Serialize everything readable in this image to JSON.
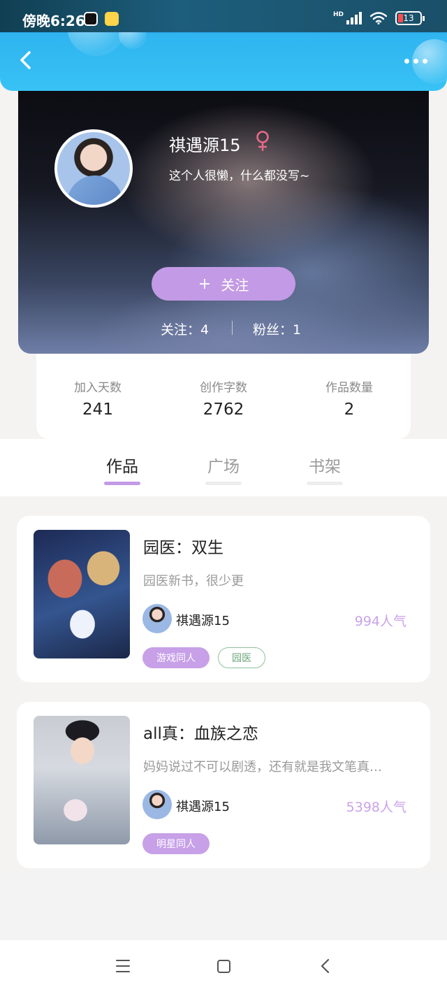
{
  "status_bar": {
    "time": "傍晚6:26",
    "network_label": "HD",
    "battery_level": "13"
  },
  "icons": {
    "back": "chevron-left",
    "more": "more-horizontal",
    "gender": "female-symbol",
    "nav_menu": "menu-lines",
    "nav_home": "square",
    "nav_back": "chevron-left"
  },
  "colors": {
    "accent": "#c39ae5",
    "header_blue": "#38c2f5",
    "gender_pink": "#e66a8a",
    "tag_green": "#6aa67a"
  },
  "profile": {
    "name": "祺遇源15",
    "bio": "这个人很懒，什么都没写~",
    "follow_plus": "+",
    "follow_label": "关注",
    "following": "关注：4",
    "followers": "粉丝：1"
  },
  "stats": [
    {
      "label": "加入天数",
      "value": "241"
    },
    {
      "label": "创作字数",
      "value": "2762"
    },
    {
      "label": "作品数量",
      "value": "2"
    }
  ],
  "tabs": [
    {
      "label": "作品",
      "active": true
    },
    {
      "label": "广场",
      "active": false
    },
    {
      "label": "书架",
      "active": false
    }
  ],
  "works": [
    {
      "title": "园医：双生",
      "description": "园医新书，很少更",
      "author": "祺遇源15",
      "popularity": "994人气",
      "tags": [
        "游戏同人",
        "园医"
      ]
    },
    {
      "title": "all真：血族之恋",
      "description": "妈妈说过不可以剧透，还有就是我文笔真…",
      "author": "祺遇源15",
      "popularity": "5398人气",
      "tags": [
        "明星同人"
      ]
    }
  ]
}
